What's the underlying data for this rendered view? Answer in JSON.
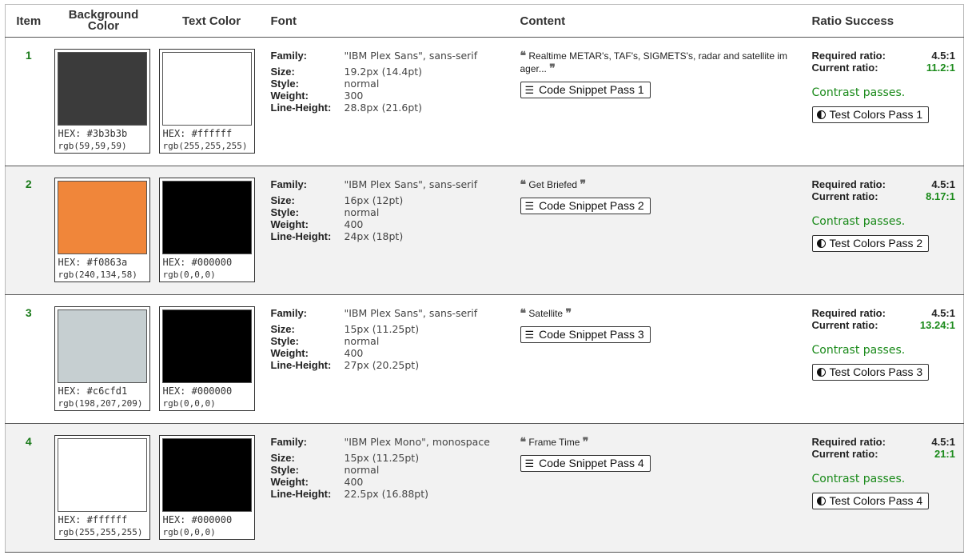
{
  "headers": {
    "item": "Item",
    "bg": "Background Color",
    "text": "Text Color",
    "font": "Font",
    "content": "Content",
    "ratio": "Ratio Success"
  },
  "font_labels": {
    "family": "Family:",
    "size": "Size:",
    "style": "Style:",
    "weight": "Weight:",
    "line_height": "Line-Height:"
  },
  "ratio_labels": {
    "required": "Required ratio:",
    "current": "Current ratio:"
  },
  "rows": [
    {
      "num": "1",
      "bg": {
        "hex_label": "HEX: #3b3b3b",
        "rgb": "rgb(59,59,59)",
        "color": "#3b3b3b"
      },
      "tc": {
        "hex_label": "HEX: #ffffff",
        "rgb": "rgb(255,255,255)",
        "color": "#ffffff"
      },
      "font": {
        "family": "\"IBM Plex Sans\", sans-serif",
        "size": "19.2px (14.4pt)",
        "style": "normal",
        "weight": "300",
        "line_height": "28.8px (21.6pt)"
      },
      "content": "Realtime METAR's, TAF's, SIGMETS's, radar and satellite im ager...",
      "snippet": "Code Snippet Pass 1",
      "required": "4.5:1",
      "current": "11.2:1",
      "status": "Contrast passes.",
      "test": "Test Colors Pass 1"
    },
    {
      "num": "2",
      "bg": {
        "hex_label": "HEX: #f0863a",
        "rgb": "rgb(240,134,58)",
        "color": "#f0863a"
      },
      "tc": {
        "hex_label": "HEX: #000000",
        "rgb": "rgb(0,0,0)",
        "color": "#000000"
      },
      "font": {
        "family": "\"IBM Plex Sans\", sans-serif",
        "size": "16px (12pt)",
        "style": "normal",
        "weight": "400",
        "line_height": "24px (18pt)"
      },
      "content": "Get Briefed",
      "snippet": "Code Snippet Pass 2",
      "required": "4.5:1",
      "current": "8.17:1",
      "status": "Contrast passes.",
      "test": "Test Colors Pass 2"
    },
    {
      "num": "3",
      "bg": {
        "hex_label": "HEX: #c6cfd1",
        "rgb": "rgb(198,207,209)",
        "color": "#c6cfd1"
      },
      "tc": {
        "hex_label": "HEX: #000000",
        "rgb": "rgb(0,0,0)",
        "color": "#000000"
      },
      "font": {
        "family": "\"IBM Plex Sans\", sans-serif",
        "size": "15px (11.25pt)",
        "style": "normal",
        "weight": "400",
        "line_height": "27px (20.25pt)"
      },
      "content": "Satellite",
      "snippet": "Code Snippet Pass 3",
      "required": "4.5:1",
      "current": "13.24:1",
      "status": "Contrast passes.",
      "test": "Test Colors Pass 3"
    },
    {
      "num": "4",
      "bg": {
        "hex_label": "HEX: #ffffff",
        "rgb": "rgb(255,255,255)",
        "color": "#ffffff"
      },
      "tc": {
        "hex_label": "HEX: #000000",
        "rgb": "rgb(0,0,0)",
        "color": "#000000"
      },
      "font": {
        "family": "\"IBM Plex Mono\", monospace",
        "size": "15px (11.25pt)",
        "style": "normal",
        "weight": "400",
        "line_height": "22.5px (16.88pt)"
      },
      "content": "Frame Time",
      "snippet": "Code Snippet Pass 4",
      "required": "4.5:1",
      "current": "21:1",
      "status": "Contrast passes.",
      "test": "Test Colors Pass 4"
    }
  ],
  "colors": {
    "pass_green": "#1a8a1a",
    "item_green": "#1a7a1a",
    "alt_row": "#f2f2f2"
  },
  "icons": {
    "quote_open": "quote-open-icon",
    "quote_close": "quote-close-icon",
    "snippet": "align-justify-icon",
    "contrast": "half-circle-contrast-icon"
  }
}
